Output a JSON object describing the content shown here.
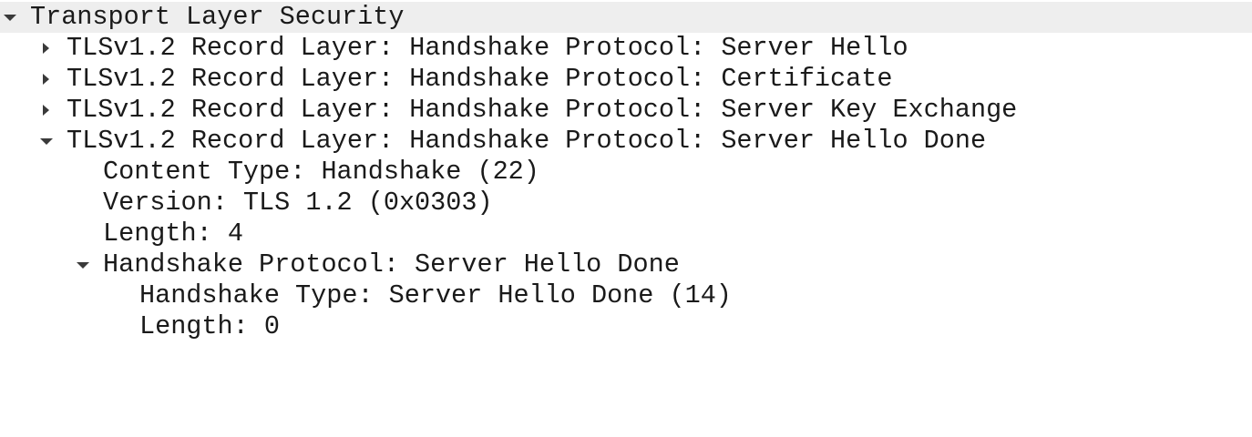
{
  "tree": {
    "root": {
      "label": "Transport Layer Security",
      "expanded": true
    },
    "records": [
      {
        "label": "TLSv1.2 Record Layer: Handshake Protocol: Server Hello",
        "expanded": false
      },
      {
        "label": "TLSv1.2 Record Layer: Handshake Protocol: Certificate",
        "expanded": false
      },
      {
        "label": "TLSv1.2 Record Layer: Handshake Protocol: Server Key Exchange",
        "expanded": false
      },
      {
        "label": "TLSv1.2 Record Layer: Handshake Protocol: Server Hello Done",
        "expanded": true
      }
    ],
    "record_fields": [
      "Content Type: Handshake (22)",
      "Version: TLS 1.2 (0x0303)",
      "Length: 4"
    ],
    "handshake": {
      "label": "Handshake Protocol: Server Hello Done",
      "expanded": true,
      "fields": [
        "Handshake Type: Server Hello Done (14)",
        "Length: 0"
      ]
    }
  },
  "colors": {
    "selected_row_bg": "#eeeeee",
    "text": "#1a1a1a",
    "arrow": "#3a3a3a"
  },
  "icons": {
    "expanded": "triangle-down-icon",
    "collapsed": "triangle-right-icon"
  }
}
